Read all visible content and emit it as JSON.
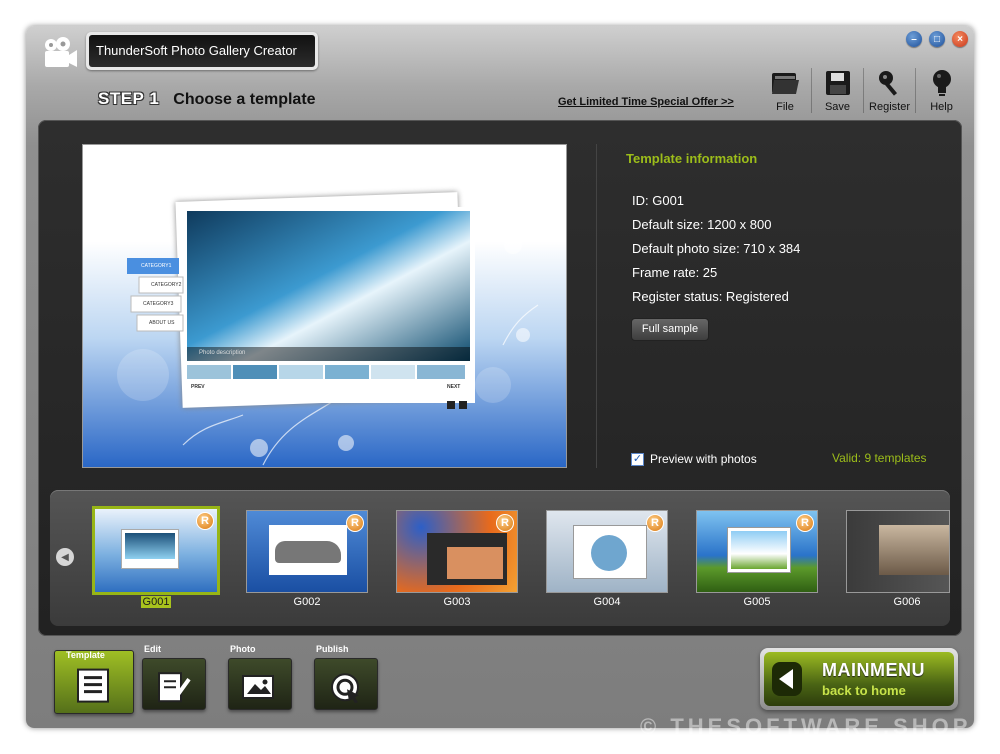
{
  "window": {
    "title": "ThunderSoft Photo Gallery Creator"
  },
  "step": {
    "number": "STEP 1",
    "title": "Choose a template"
  },
  "offer_link": "Get Limited Time Special Offer >>",
  "toolbar": [
    {
      "label": "File",
      "icon": "folder-icon"
    },
    {
      "label": "Save",
      "icon": "floppy-disk-icon"
    },
    {
      "label": "Register",
      "icon": "key-icon"
    },
    {
      "label": "Help",
      "icon": "lightbulb-icon"
    }
  ],
  "preview": {
    "nav": [
      "CATEGORY1",
      "CATEGORY2",
      "CATEGORY3",
      "ABOUT US"
    ],
    "caption": "Photo description",
    "prev": "PREV",
    "next": "NEXT"
  },
  "info": {
    "title": "Template information",
    "lines": [
      "ID: G001",
      "Default size: 1200 x 800",
      "Default photo size: 710 x 384",
      "Frame rate: 25",
      "Register status: Registered"
    ],
    "full_sample": "Full sample",
    "preview_with_photos": "Preview with photos",
    "preview_checked": true,
    "valid": "Valid: 9 templates"
  },
  "templates": [
    {
      "id": "G001",
      "selected": true,
      "badge": "R",
      "theme": "#2f6fc0"
    },
    {
      "id": "G002",
      "selected": false,
      "badge": "R",
      "theme": "#1a4fa3"
    },
    {
      "id": "G003",
      "selected": false,
      "badge": "R",
      "theme": "#e86a1c"
    },
    {
      "id": "G004",
      "selected": false,
      "badge": "R",
      "theme": "#b7c7d6"
    },
    {
      "id": "G005",
      "selected": false,
      "badge": "R",
      "theme": "#2a73c9"
    },
    {
      "id": "G006",
      "selected": false,
      "badge": "",
      "theme": "#3b3b3b"
    }
  ],
  "tabs": [
    {
      "label": "Template",
      "active": true
    },
    {
      "label": "Edit",
      "active": false
    },
    {
      "label": "Photo",
      "active": false
    },
    {
      "label": "Publish",
      "active": false
    }
  ],
  "mainmenu": {
    "title": "MAINMENU",
    "subtitle": "back to home"
  },
  "watermark": "© THESOFTWARE.SHOP"
}
